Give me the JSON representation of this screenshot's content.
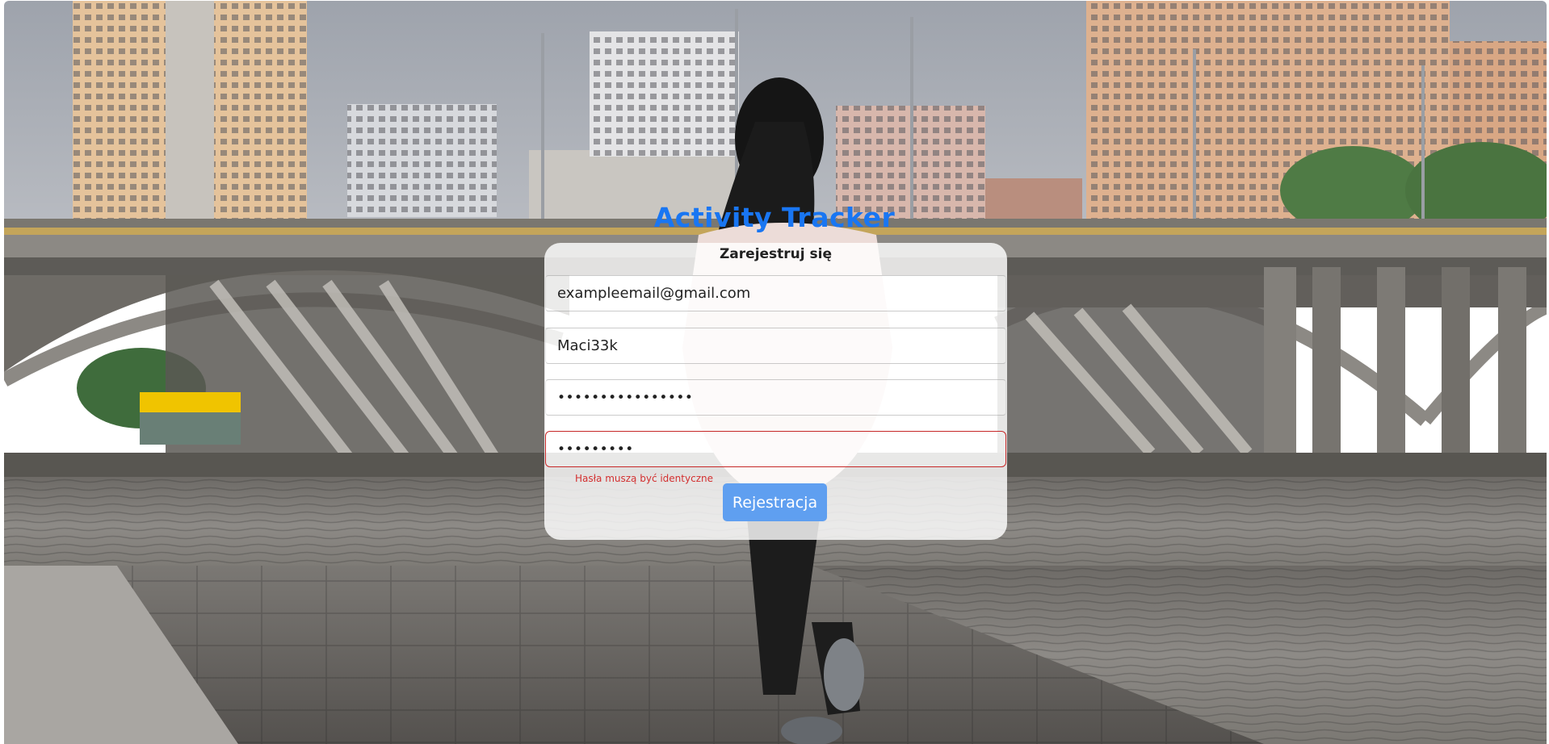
{
  "app": {
    "title": "Activity Tracker"
  },
  "register_form": {
    "heading": "Zarejestruj się",
    "email_value": "exampleemail@gmail.com",
    "username_value": "Maci33k",
    "password_mask": "••••••••••••••••",
    "confirm_password_mask": "•••••••••",
    "error_message": "Hasła muszą być identyczne",
    "submit_label": "Rejestracja"
  },
  "colors": {
    "title": "#1976f2",
    "button": "#5f9ff0",
    "error": "#d32f2f"
  }
}
